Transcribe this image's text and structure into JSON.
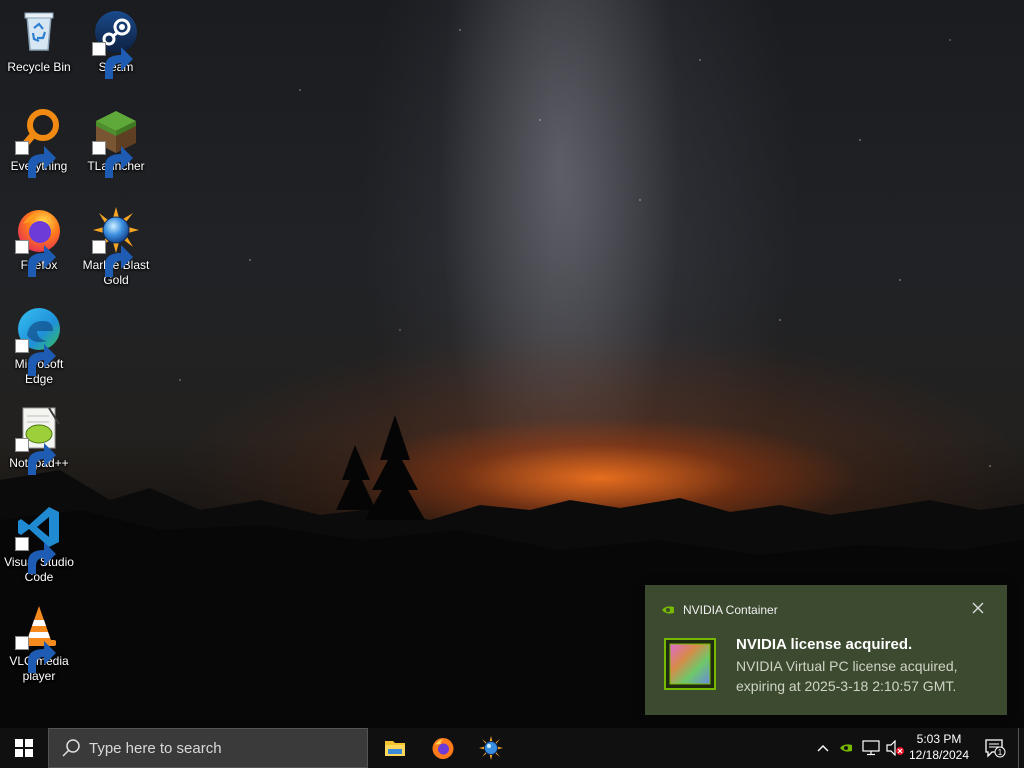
{
  "desktop": {
    "icons": [
      {
        "label": "Recycle Bin",
        "icon": "recycle-bin-icon"
      },
      {
        "label": "Steam",
        "icon": "steam-icon"
      },
      {
        "label": "Everything",
        "icon": "everything-search-icon"
      },
      {
        "label": "TLauncher",
        "icon": "tlauncher-icon"
      },
      {
        "label": "Firefox",
        "icon": "firefox-icon"
      },
      {
        "label": "Marble Blast Gold",
        "icon": "marble-blast-icon"
      },
      {
        "label": "Microsoft Edge",
        "icon": "edge-icon"
      },
      {
        "label": "Notepad++",
        "icon": "notepadpp-icon"
      },
      {
        "label": "Visual Studio Code",
        "icon": "vscode-icon"
      },
      {
        "label": "VLC media player",
        "icon": "vlc-icon"
      }
    ]
  },
  "notification": {
    "app_name": "NVIDIA Container",
    "title": "NVIDIA license acquired.",
    "body": "NVIDIA Virtual PC license acquired, expiring at 2025-3-18 2:10:57 GMT.",
    "accent_color": "#76b900",
    "background_color": "#3c4a2f"
  },
  "taskbar": {
    "search_placeholder": "Type here to search",
    "pinned_apps": [
      "file-explorer-icon",
      "firefox-icon",
      "marble-blast-icon"
    ],
    "tray": {
      "time": "5:03 PM",
      "date": "12/18/2024",
      "notification_count": "1",
      "icons": [
        "chevron-up-icon",
        "nvidia-tray-icon",
        "network-icon",
        "volume-muted-icon",
        "action-center-icon"
      ]
    }
  }
}
